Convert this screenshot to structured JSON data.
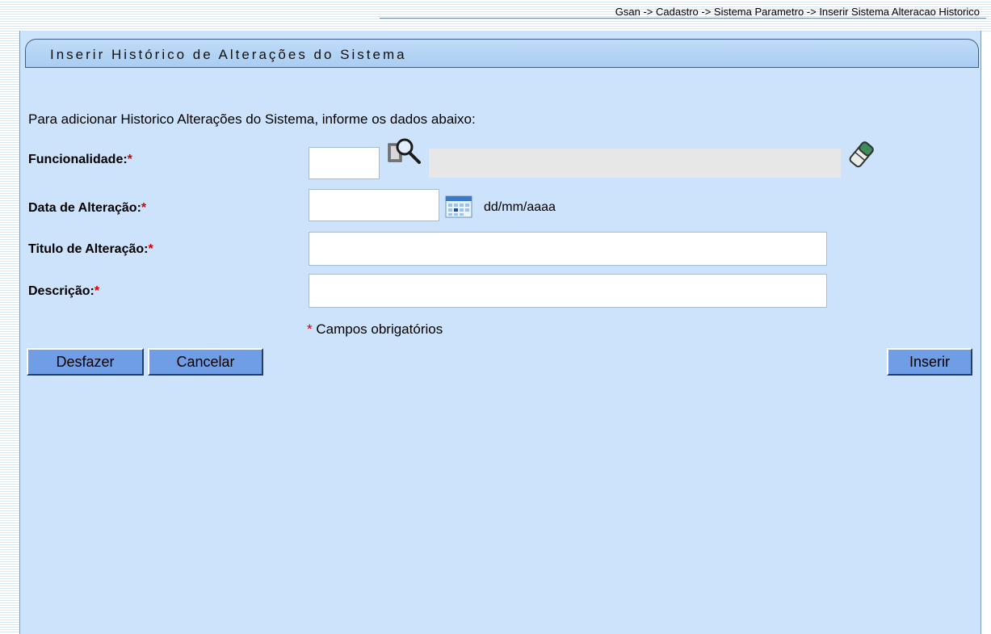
{
  "breadcrumb": "Gsan -> Cadastro -> Sistema Parametro -> Inserir Sistema Alteracao Historico",
  "title": "Inserir Histórico de Alterações do Sistema",
  "intro": "Para adicionar Historico Alterações do Sistema, informe os dados abaixo:",
  "fields": {
    "funcionalidade": {
      "label": "Funcionalidade:",
      "required": "*",
      "value": ""
    },
    "data_alteracao": {
      "label": "Data de Alteração:",
      "required": "*",
      "value": "",
      "hint": "dd/mm/aaaa"
    },
    "titulo": {
      "label": "Titulo de Alteração:",
      "required": "*",
      "value": ""
    },
    "descricao": {
      "label": "Descrição:",
      "required": "*",
      "value": ""
    }
  },
  "required_note": {
    "star": "*",
    "text": "Campos obrigatórios"
  },
  "buttons": {
    "desfazer": "Desfazer",
    "cancelar": "Cancelar",
    "inserir": "Inserir"
  },
  "colors": {
    "panel_bg": "#cce3fb",
    "button_bg": "#6f9ee6",
    "required": "#d00000"
  }
}
